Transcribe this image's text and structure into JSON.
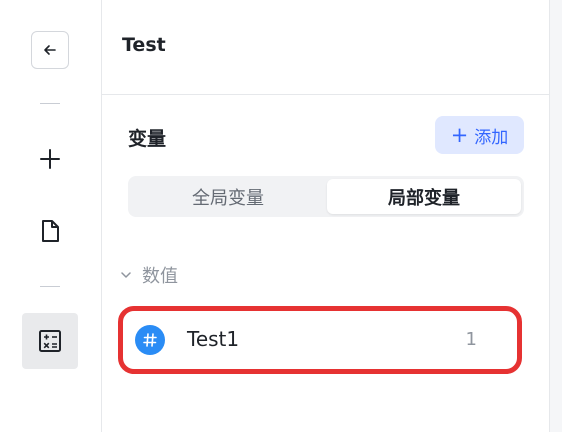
{
  "rail": {
    "icons": [
      "back-arrow-icon",
      "plus-icon",
      "document-icon",
      "calculator-icon"
    ]
  },
  "header": {
    "title": "Test"
  },
  "variables": {
    "title": "变量",
    "add_label": "添加",
    "tabs": [
      {
        "label": "全局变量",
        "active": false
      },
      {
        "label": "局部变量",
        "active": true
      }
    ],
    "groups": [
      {
        "label": "数值",
        "expanded": true,
        "items": [
          {
            "name": "Test1",
            "count": "1",
            "icon": "hash-icon"
          }
        ]
      }
    ]
  },
  "colors": {
    "accent": "#3366ff",
    "accent_bg": "#e0e8ff",
    "highlight_border": "#e63232",
    "item_icon_bg": "#2a8cf5"
  }
}
